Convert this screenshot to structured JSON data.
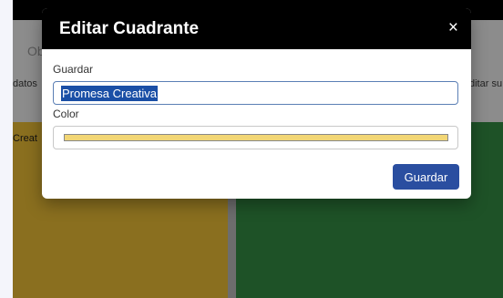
{
  "background": {
    "tab_label": "Ob",
    "left_text": "datos",
    "right_text": "ditar su",
    "panel_left_label": "Creat",
    "panel_left_color": "#8a6f1f",
    "panel_right_color": "#1e5227"
  },
  "modal": {
    "title": "Editar Cuadrante",
    "close_glyph": "×",
    "fields": {
      "name_label": "Guardar",
      "name_value": "Promesa Creativa",
      "color_label": "Color",
      "color_value": "#f2d675"
    },
    "save_label": "Guardar"
  }
}
